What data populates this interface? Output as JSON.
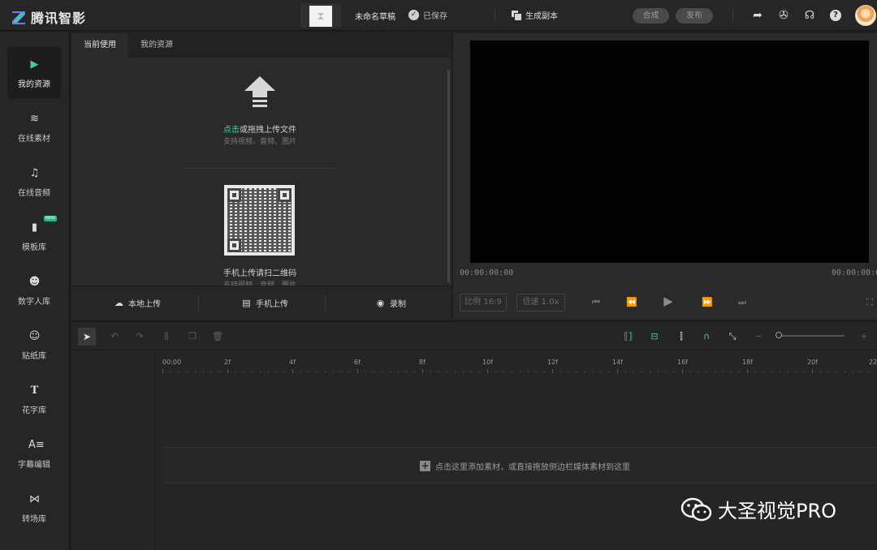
{
  "header": {
    "brand": "腾讯智影",
    "draft_name": "未命名草稿",
    "save_status": "已保存",
    "copy_label": "生成副本",
    "compose_label": "合成",
    "publish_label": "发布"
  },
  "sidebar": {
    "items": [
      {
        "label": "我的资源",
        "icon": "play-folder-icon"
      },
      {
        "label": "在线素材",
        "icon": "layers-icon"
      },
      {
        "label": "在线音频",
        "icon": "music-note-icon"
      },
      {
        "label": "模板库",
        "icon": "template-icon",
        "badge": "NEW"
      },
      {
        "label": "数字人库",
        "icon": "digital-human-icon"
      },
      {
        "label": "贴纸库",
        "icon": "sticker-icon"
      },
      {
        "label": "花字库",
        "icon": "text-t-icon"
      },
      {
        "label": "字幕编辑",
        "icon": "subtitle-icon"
      },
      {
        "label": "转场库",
        "icon": "transition-icon"
      }
    ]
  },
  "resources": {
    "tabs": [
      "当前使用",
      "我的资源"
    ],
    "upload_link": "点击",
    "upload_text": "或拖拽上传文件",
    "upload_hint": "支持视频、音频、图片",
    "qr_text": "手机上传请扫二维码",
    "qr_hint": "支持视频、音频、图片",
    "footer": {
      "local_upload": "本地上传",
      "phone_upload": "手机上传",
      "record": "录制"
    }
  },
  "preview": {
    "timecode_current": "00:00:00:00",
    "timecode_total": "00:00:00:00",
    "ratio_label": "比例 16:9",
    "speed_label": "倍速 1.0x"
  },
  "timeline": {
    "ruler_labels": [
      "00:00",
      "2f",
      "4f",
      "6f",
      "8f",
      "10f",
      "12f",
      "14f",
      "16f",
      "18f",
      "20f",
      "22"
    ],
    "drop_hint": "点击这里添加素材，或直接拖放侧边栏媒体素材到这里"
  },
  "watermark": {
    "text": "大圣视觉PRO"
  },
  "colors": {
    "accent": "#4ecb95",
    "background": "#1f1f1f",
    "panel": "#2a2a2a"
  }
}
